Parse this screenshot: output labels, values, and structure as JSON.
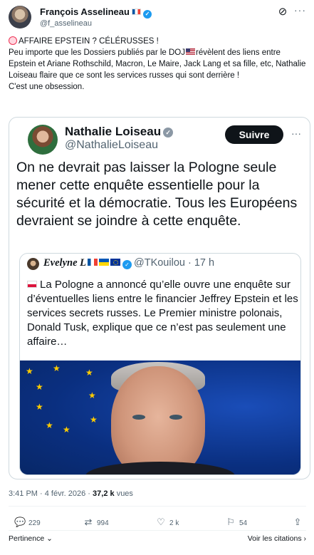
{
  "author": {
    "name": "François Asselineau",
    "handle": "@f_asselineau"
  },
  "post": {
    "line1": "AFFAIRE EPSTEIN ? CÉLÉRUSSES !",
    "para_before_flag": "Peu importe que les Dossiers publiés par le DOJ",
    "para_after_flag": "révèlent des liens entre Epstein et Ariane Rothschild, Macron, Le Maire, Jack Lang et sa fille, etc, Nathalie Loiseau flaire que ce sont les services russes qui sont derrière !",
    "line3": "C'est une obsession."
  },
  "media": {
    "name": "Nathalie Loiseau",
    "handle": "@NathalieLoiseau",
    "follow_label": "Suivre",
    "text": "On ne devrait pas laisser la Pologne seule mener cette enquête essentielle pour la sécurité et la démocratie. Tous les Européens devraient se joindre à cette enquête.",
    "quote": {
      "name": "Evelyne L",
      "handle": "@TKouilou",
      "time": "17 h",
      "text": "La Pologne a annoncé qu’elle ouvre une enquête sur d’éventuelles liens entre le financier Jeffrey Epstein et les services secrets russes. Le Premier ministre polonais, Donald Tusk, explique que ce n’est pas seulement une affaire…"
    }
  },
  "meta": {
    "time": "3:41 PM",
    "date": "4 févr. 2026",
    "views_count": "37,2 k",
    "views_label": "vues"
  },
  "actions": {
    "replies": "229",
    "reposts": "994",
    "likes": "2 k",
    "bookmarks": "54"
  },
  "footer": {
    "relevance": "Pertinence",
    "quotes": "Voir les citations"
  },
  "icons": [
    "grok-icon",
    "more-icon",
    "reply-icon",
    "repost-icon",
    "like-icon",
    "bookmark-icon",
    "share-icon",
    "chevron-down-icon",
    "chevron-right-icon"
  ]
}
